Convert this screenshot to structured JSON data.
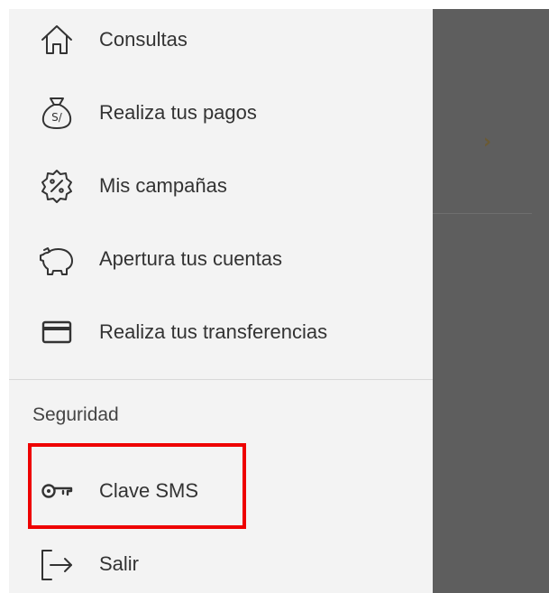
{
  "menu": {
    "items": [
      {
        "label": "Consultas",
        "icon": "home-icon"
      },
      {
        "label": "Realiza tus pagos",
        "icon": "money-bag-icon"
      },
      {
        "label": "Mis campañas",
        "icon": "discount-badge-icon"
      },
      {
        "label": "Apertura tus cuentas",
        "icon": "piggy-bank-icon"
      },
      {
        "label": "Realiza tus transferencias",
        "icon": "credit-card-icon"
      }
    ],
    "security": {
      "header": "Seguridad",
      "items": [
        {
          "label": "Clave SMS",
          "icon": "key-icon"
        },
        {
          "label": "Salir",
          "icon": "logout-icon"
        }
      ]
    }
  },
  "colors": {
    "drawer_bg": "#f3f3f3",
    "scrim": "#5e5e5e",
    "icon": "#333333",
    "highlight": "#ee0000",
    "chevron": "#6b5a33"
  }
}
